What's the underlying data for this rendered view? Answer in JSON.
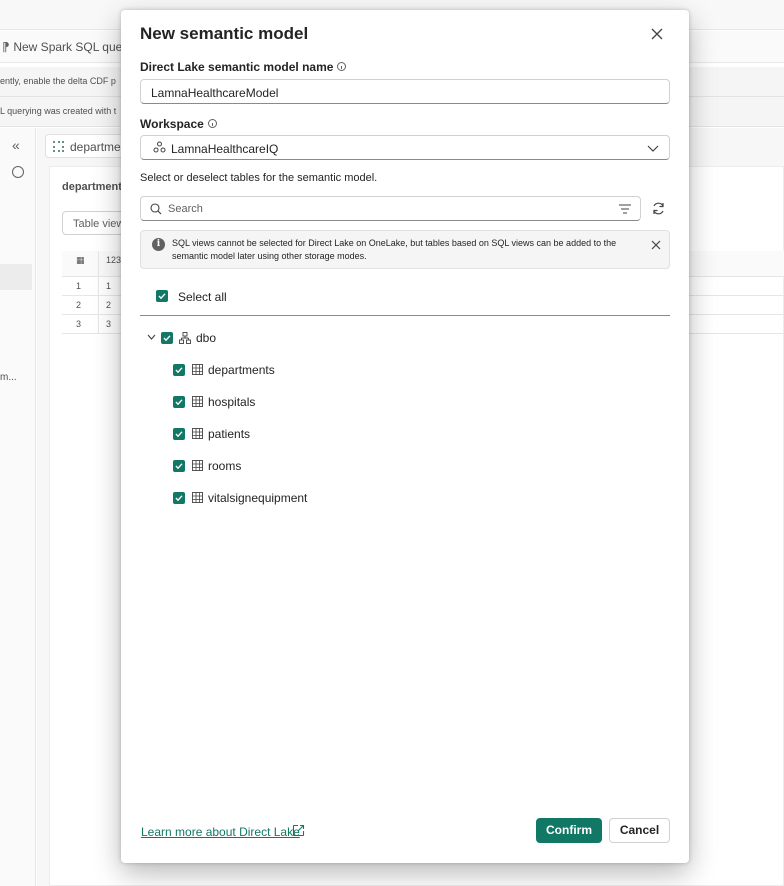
{
  "background": {
    "toolbar": {
      "spark_query_label": "New Spark SQL query"
    },
    "banners": [
      "ently, enable the delta CDF p",
      "L querying was created with t"
    ],
    "tab_label": "departmen",
    "card_label": "department",
    "table_view_label": "Table view",
    "grid": {
      "header_icon": "table-icon",
      "type_label": "123",
      "rows": [
        {
          "num": "1",
          "val": "1"
        },
        {
          "num": "2",
          "val": "2"
        },
        {
          "num": "3",
          "val": "3"
        }
      ]
    },
    "side_more_label": "m..."
  },
  "dialog": {
    "title": "New semantic model",
    "name_label": "Direct Lake semantic model name",
    "name_value": "LamnaHealthcareModel",
    "workspace_label": "Workspace",
    "workspace_value": "LamnaHealthcareIQ",
    "select_hint": "Select or deselect tables for the semantic model.",
    "search_placeholder": "Search",
    "notice_text": "SQL views cannot be selected for Direct Lake on OneLake, but tables based on SQL views can be added to the semantic model later using other storage modes.",
    "select_all_label": "Select all",
    "tree": {
      "schema": "dbo",
      "tables": [
        "departments",
        "hospitals",
        "patients",
        "rooms",
        "vitalsignequipment"
      ]
    },
    "learn_more_label": "Learn more about Direct Lake",
    "confirm_label": "Confirm",
    "cancel_label": "Cancel"
  },
  "colors": {
    "accent": "#117865",
    "border": "#d1d1d1",
    "notice_bg": "#f5f5f5"
  }
}
